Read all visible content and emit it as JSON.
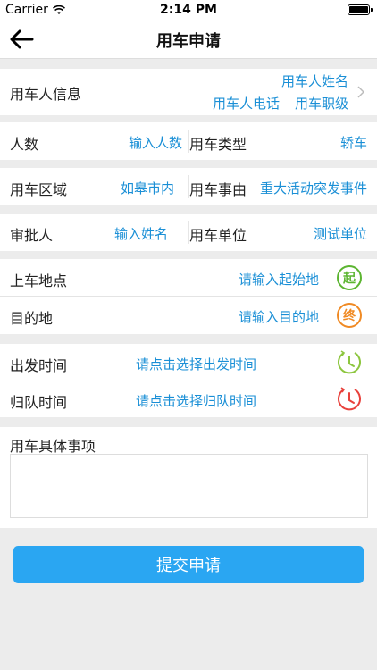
{
  "status_bar": {
    "carrier": "Carrier",
    "time": "2:14 PM"
  },
  "nav": {
    "title": "用车申请"
  },
  "user_info": {
    "label": "用车人信息",
    "name_value": "用车人姓名",
    "phone_value": "用车人电话",
    "rank_value": "用车职级"
  },
  "row_people": {
    "count_label": "人数",
    "count_value": "输入人数",
    "type_label": "用车类型",
    "type_value": "轿车"
  },
  "row_area": {
    "area_label": "用车区域",
    "area_value": "如皋市内",
    "reason_label": "用车事由",
    "reason_value": "重大活动突发事件"
  },
  "row_approver": {
    "approver_label": "审批人",
    "approver_value": "输入姓名",
    "unit_label": "用车单位",
    "unit_value": "测试单位"
  },
  "locations": {
    "start_label": "上车地点",
    "start_placeholder": "请输入起始地",
    "start_icon_text": "起",
    "end_label": "目的地",
    "end_placeholder": "请输入目的地",
    "end_icon_text": "终"
  },
  "times": {
    "depart_label": "出发时间",
    "depart_placeholder": "请点击选择出发时间",
    "return_label": "归队时间",
    "return_placeholder": "请点击选择归队时间"
  },
  "details": {
    "label": "用车具体事项"
  },
  "submit": {
    "label": "提交申请"
  },
  "colors": {
    "accent": "#1a8fd6",
    "button": "#2aa6f2",
    "start_icon": "#5cb531",
    "end_icon": "#f08a24",
    "depart_clock": "#8dc63f",
    "return_clock": "#e8413c"
  }
}
